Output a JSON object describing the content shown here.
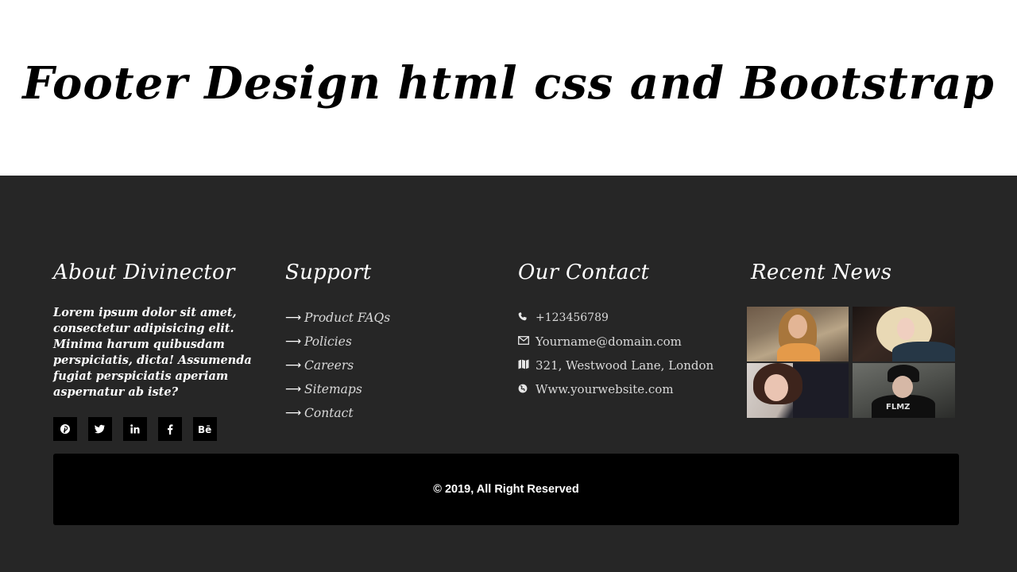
{
  "hero": {
    "title": "Footer Design html css and Bootstrap"
  },
  "about": {
    "heading": "About Divinector",
    "text": "Lorem ipsum dolor sit amet, consectetur adipisicing elit. Minima harum quibusdam perspiciatis, dicta! Assumenda fugiat perspiciatis aperiam aspernatur ab iste?",
    "socials": [
      {
        "icon": "pinterest-icon",
        "glyph": "℗"
      },
      {
        "icon": "twitter-icon",
        "glyph": "🐦"
      },
      {
        "icon": "linkedin-icon",
        "glyph": "in"
      },
      {
        "icon": "facebook-icon",
        "glyph": "f"
      },
      {
        "icon": "behance-icon",
        "glyph": "Bē"
      }
    ]
  },
  "support": {
    "heading": "Support",
    "links": [
      "Product FAQs",
      "Policies",
      "Careers",
      "Sitemaps",
      "Contact"
    ]
  },
  "contact": {
    "heading": "Our Contact",
    "phone": "+123456789",
    "email": "Yourname@domain.com",
    "address": "321, Westwood Lane, London",
    "website": "Www.yourwebsite.com"
  },
  "news": {
    "heading": "Recent News",
    "thumb_caption": "FLMZ"
  },
  "footer": {
    "copyright": "© 2019, All Right Reserved"
  },
  "colors": {
    "footer_bg": "#262626",
    "bar_bg": "#000000",
    "text": "#ffffff"
  }
}
